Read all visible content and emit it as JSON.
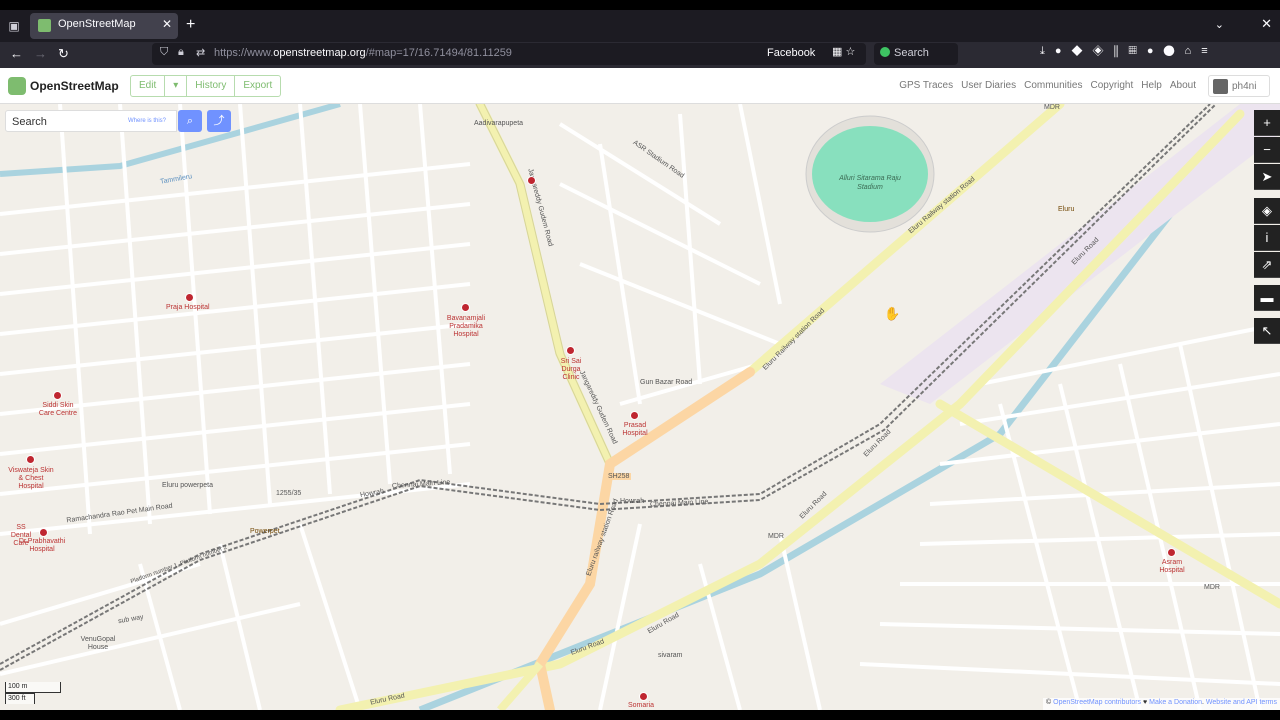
{
  "browser": {
    "tab_title": "OpenStreetMap",
    "url_prefix": "https://www.",
    "url_domain": "openstreetmap.org",
    "url_rest": "/#map=17/16.71494/81.11259",
    "bookmark": "Facebook",
    "search_label": "Search"
  },
  "osm": {
    "brand": "OpenStreetMap",
    "edit": "Edit",
    "edit_dropdown": "▾",
    "history": "History",
    "export": "Export",
    "links": [
      "GPS Traces",
      "User Diaries",
      "Communities",
      "Copyright",
      "Help",
      "About"
    ],
    "username": "ph4ni"
  },
  "search": {
    "placeholder": "Search",
    "where_is_this": "Where is this?"
  },
  "map": {
    "scale_metric": "100 m",
    "scale_imperial": "300 ft",
    "attribution_prefix": "© ",
    "attribution_link1": "OpenStreetMap contributors",
    "attribution_heart": " ♥ ",
    "attribution_link2": "Make a Donation",
    "attribution_sep": ". ",
    "attribution_link3": "Website and API terms",
    "stadium": "Alluri Sitarama Raju Stadium",
    "labels": {
      "aadivarapupeta": "Aadivarapupeta",
      "asr_stadium_road": "ASR Stadium Road",
      "jangareddy1": "Jangareddy Gudem Road",
      "jangareddy2": "Jangareddy Gudem Road",
      "eluru_railway1": "Eluru Railway station Road",
      "eluru_railway2": "Eluru Railway station Road",
      "eluru_railway3": "Eluru railway station Road",
      "gun_bazar": "Gun Bazar Road",
      "sh258": "SH258",
      "chennai_main1": "Chennai Main Line",
      "chennai_main2": "Chennai Main Line",
      "howrah1": "Howrah",
      "howrah2": "Howrah",
      "ramachandra": "Ramachandra Rao Pet Main Road",
      "eluru_road1": "Eluru Road",
      "eluru_road2": "Eluru Road",
      "eluru_road3": "Eluru Road",
      "eluru_road4": "Eluru Road",
      "eluru_road5": "Eluru Road",
      "mdr1": "MDR",
      "mdr2": "MDR",
      "mdr3": "MDR",
      "tammileru": "Tammileru",
      "eluru_station": "Eluru",
      "powerpet": "Powerpet",
      "sub_way": "sub way",
      "venugopal": "VenuGopal House",
      "eluru_powerpeta": "Eluru powerpeta",
      "num_1255": "1255/35",
      "sivaram": "sivaram",
      "platform": "Platform number 1, Platform number 2"
    },
    "pois": {
      "praja": "Praja Hospital",
      "bavanamjali": "Bavanamjali Pradamika Hospital",
      "sri_sai": "Sri Sai Durga Clinic",
      "prasad": "Prasad Hospital",
      "siddi": "Siddi Skin Care Centre",
      "viswateja": "Viswateja Skin & Chest Hospital",
      "ss_dental": "SS Dental Care",
      "prabhavathi": "Dr.Prabhavathi Hospital",
      "asram": "Asram Hospital",
      "somaria": "Somaria"
    }
  }
}
